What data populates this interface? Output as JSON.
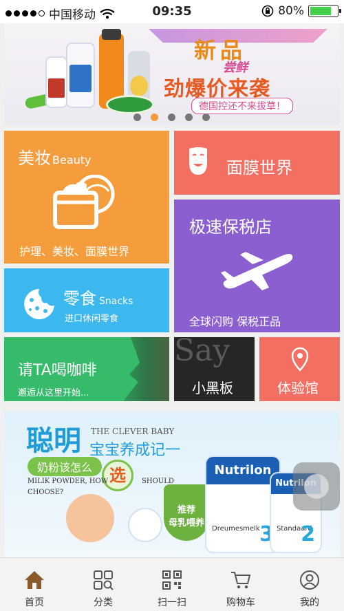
{
  "status_bar": {
    "carrier": "中国移动",
    "time": "09:35",
    "battery": "80%",
    "signal_icon": "signal-dots-icon",
    "wifi_icon": "wifi-icon",
    "lock_icon": "rotation-lock-icon"
  },
  "banner": {
    "headline": "新品",
    "tag": "尝鲜",
    "main": "劲爆价来袭",
    "slogan": "德国控还不来拔草！",
    "page_count": 5,
    "active_index": 1
  },
  "tiles": {
    "beauty": {
      "title": "美妆",
      "title_en": "Beauty",
      "subtitle": "护理、美妆、面膜世界",
      "icon": "cosmetic-cream-icon"
    },
    "mask": {
      "title": "面膜世界",
      "icon": "face-mask-icon"
    },
    "bonded": {
      "title": "极速保税店",
      "subtitle": "全球闪购 保税正品",
      "icon": "airplane-icon"
    },
    "snacks": {
      "title": "零食",
      "title_en": "Snacks",
      "subtitle": "进口休闲零食",
      "icon": "cookie-icon"
    },
    "coffee": {
      "title": "请TA喝咖啡",
      "subtitle": "邂逅从这里开始..."
    },
    "board": {
      "bg_text": "Say",
      "title": "小黑板"
    },
    "experience": {
      "title": "体验馆",
      "icon": "location-pin-icon"
    }
  },
  "promo": {
    "title": "聪明",
    "title_en": "THE CLEVER BABY",
    "subtitle": "宝宝养成记一",
    "question": "奶粉该怎么",
    "select": "选",
    "en_line1": "MILIK POWDER, HOW",
    "en_line2": "SHOULD",
    "en_line3": "CHOOSE?",
    "badge": "推荐\n母乳喂养",
    "can1_brand": "Nutrilon",
    "can1_caption": "Dreumesmelk",
    "can1_stage": "3",
    "can2_brand": "Nutrilon",
    "can2_caption": "Standaard",
    "can2_stage": "2"
  },
  "nav": [
    {
      "label": "首页",
      "icon": "home-icon"
    },
    {
      "label": "分类",
      "icon": "category-grid-icon"
    },
    {
      "label": "扫一扫",
      "icon": "qr-scan-icon"
    },
    {
      "label": "购物车",
      "icon": "cart-icon"
    },
    {
      "label": "我的",
      "icon": "user-icon"
    }
  ],
  "colors": {
    "beauty": "#f59d3d",
    "mask": "#f26f62",
    "bonded": "#8b5fd0",
    "snacks": "#3cb8ef",
    "coffee": "#35bb6a",
    "board": "#262626",
    "experience": "#f26f62"
  }
}
